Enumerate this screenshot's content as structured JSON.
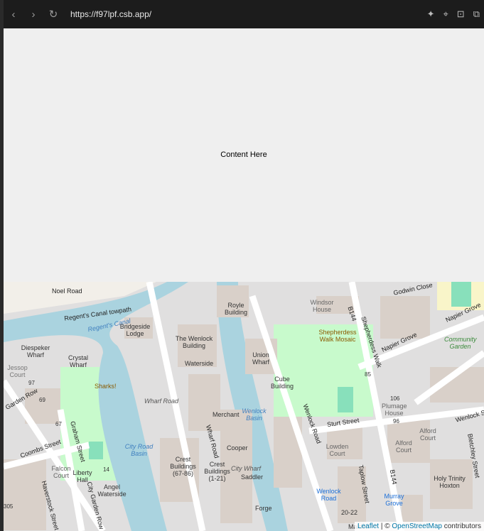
{
  "browser": {
    "url": "https://f97lpf.csb.app/",
    "back": "‹",
    "forward": "›",
    "reload": "↻",
    "icons": [
      "sparkle-icon",
      "crosshair-icon",
      "terminal-icon",
      "windows-icon"
    ]
  },
  "content": {
    "text": "Content Here"
  },
  "map": {
    "labels": {
      "noel_road": "Noel Road",
      "towpath": "Regent's Canal towpath",
      "canal": "Regent's Canal",
      "royle": "Royle Building",
      "windsor": "Windsor House",
      "godwin": "Godwin Close",
      "b144a": "B144",
      "shepherdess_walk": "Shepherdess Walk",
      "napier": "Napier Grove",
      "napier2": "Napier Grove",
      "community": "Community Garden",
      "bridgeside": "Bridgeside Lodge",
      "wenlock_bldg": "The Wenlock Building",
      "diespeker": "Diespeker Wharf",
      "crystal": "Crystal Wharf",
      "union": "Union Wharf",
      "mosaic": "Shepherdess Walk Mosaic",
      "jessop": "Jessop Court",
      "sharks": "Sharks!",
      "waterside": "Waterside",
      "wharf_road": "Wharf Road",
      "garden_row": "Garden Row",
      "cube": "Cube Building",
      "merchant": "Merchant",
      "wenlock_basin": "Wenlock Basin",
      "plumage": "Plumage House",
      "wenlock_st": "Wenlock Street",
      "sturt": "Sturt Street",
      "wenlock_road": "Wenlock Road",
      "alford": "Alford Court",
      "alford2": "Alford Court",
      "lowden": "Lowden Court",
      "city_road_basin": "City Road Basin",
      "graham": "Graham Street",
      "coombs": "Coombs Street",
      "falcon": "Falcon Court",
      "liberty": "Liberty Hall",
      "angel": "Angel Waterside",
      "crest1": "Crest Buildings (67-86)",
      "crest2": "Crest Buildings (1-21)",
      "cooper": "Cooper",
      "city_wharf": "City Wharf",
      "saddler": "Saddler",
      "forge": "Forge",
      "wharf_road2": "Wharf Road",
      "taplow": "Taplow Street",
      "b144b": "B144",
      "bletchley": "Bletchley Street",
      "holy": "Holy Trinity Hoxton",
      "wenlock_stop": "Wenlock Road",
      "murray": "Murray Grove",
      "n2022": "20-22",
      "maldon": "Maldon",
      "haverstock": "Haverstock Street",
      "city_garden": "City Garden Row",
      "n305": "305",
      "n97": "97",
      "n69": "69",
      "n67": "67",
      "n85": "85",
      "n96": "96",
      "n106": "106",
      "n14": "14"
    },
    "attribution": {
      "leaflet": "Leaflet",
      "sep": " | © ",
      "osm": "OpenStreetMap",
      "suffix": " contributors"
    },
    "colors": {
      "water": "#aad3df",
      "park": "#c8facc",
      "building": "#d9d0c9",
      "road": "#ffffff",
      "land": "#f2efe9"
    }
  }
}
